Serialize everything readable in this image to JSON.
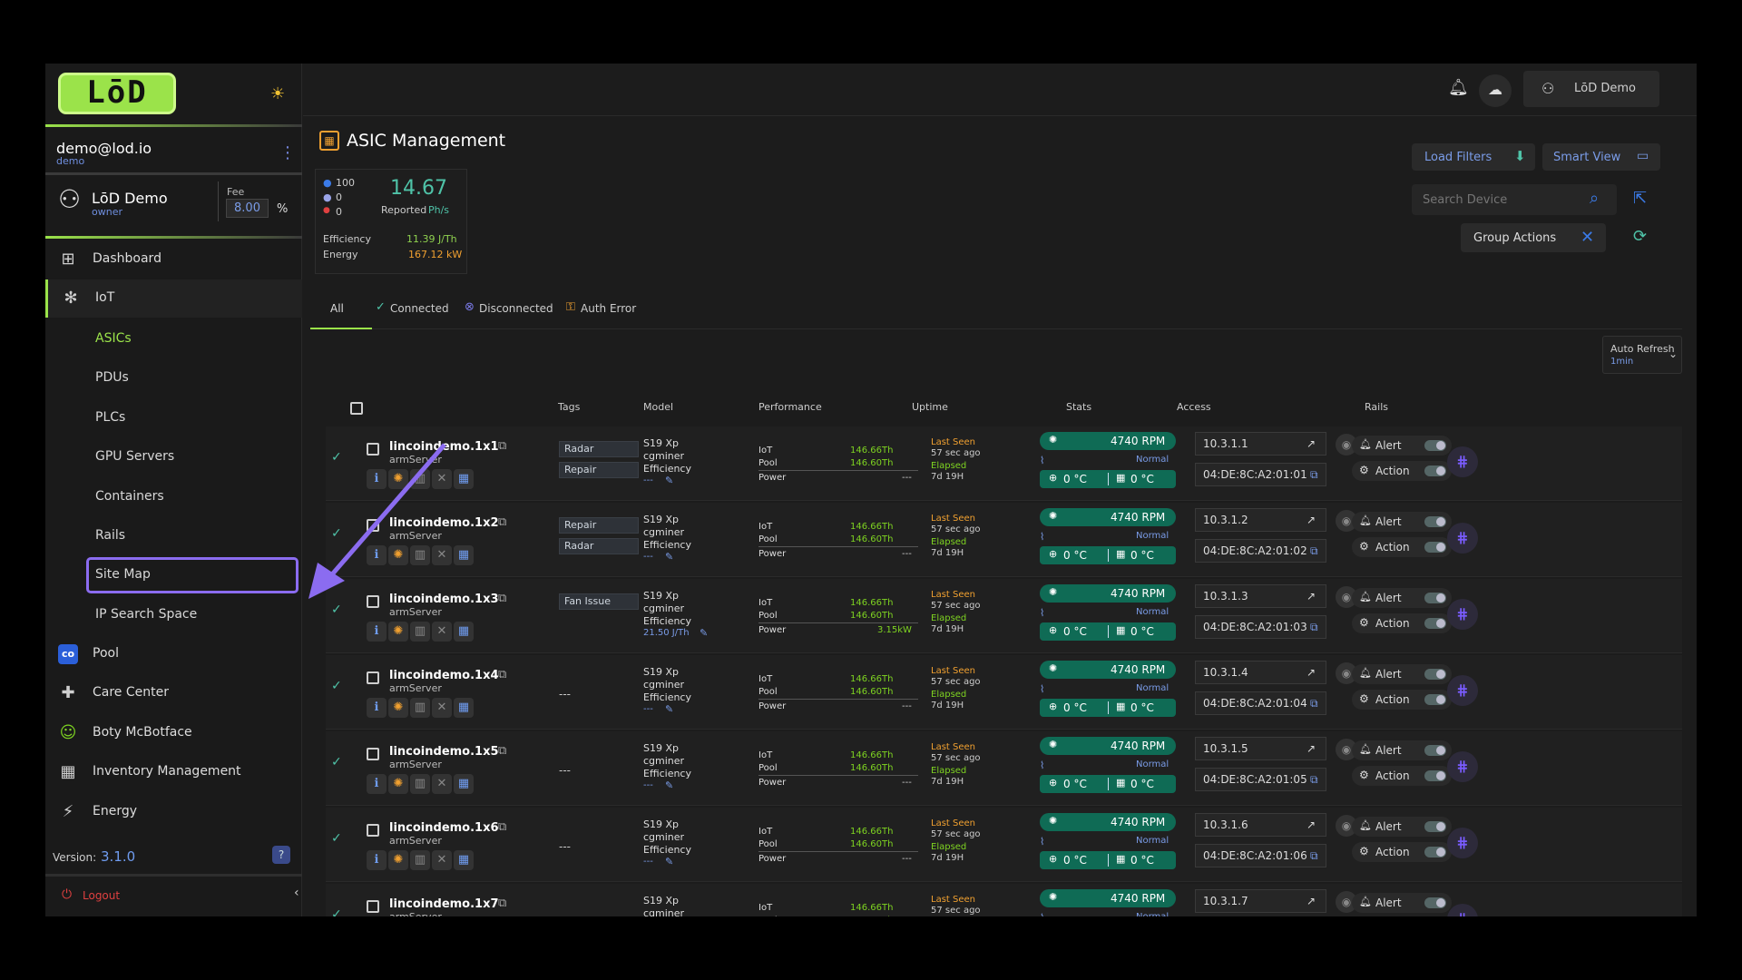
{
  "sidebar": {
    "logo": "LōD",
    "email": "demo@lod.io",
    "email_sub": "demo",
    "user_name": "LōD Demo",
    "user_role": "owner",
    "fee_label": "Fee",
    "fee_value": "8.00",
    "fee_unit": "%",
    "nav": [
      {
        "label": "Dashboard",
        "icon": "dashboard-icon",
        "glyph": "⊞"
      },
      {
        "label": "IoT",
        "icon": "iot-icon",
        "glyph": "✻"
      }
    ],
    "sub_items": [
      "ASICs",
      "PDUs",
      "PLCs",
      "GPU Servers",
      "Containers",
      "Rails",
      "Site Map",
      "IP Search Space"
    ],
    "nav2": [
      {
        "label": "Pool",
        "icon": "pool-icon",
        "glyph": "co"
      },
      {
        "label": "Care Center",
        "icon": "care-center-icon",
        "glyph": "✚"
      },
      {
        "label": "Boty McBotface",
        "icon": "bot-icon",
        "glyph": "☺"
      },
      {
        "label": "Inventory Management",
        "icon": "inventory-icon",
        "glyph": "▦"
      },
      {
        "label": "Energy",
        "icon": "energy-icon",
        "glyph": "⚡"
      }
    ],
    "version_label": "Version:",
    "version": "3.1.0",
    "logout": "Logout"
  },
  "header": {
    "user": "LōD Demo"
  },
  "page": {
    "title": "ASIC Management",
    "summary": {
      "c1": "100",
      "c2": "0",
      "c3": "0",
      "hashrate": "14.67",
      "reported": "Reported",
      "unit": "Ph/s",
      "eff_label": "Efficiency",
      "eff_val": "11.39 J/Th",
      "energy_label": "Energy",
      "energy_val": "167.12 kW"
    },
    "load_filters": "Load Filters",
    "smart_view": "Smart View",
    "search_placeholder": "Search Device",
    "group_actions": "Group Actions",
    "tabs": [
      "All",
      "Connected",
      "Disconnected",
      "Auth Error"
    ],
    "auto_refresh": "Auto Refresh",
    "auto_refresh_val": "1min",
    "columns": [
      "Tags",
      "Model",
      "Performance",
      "Uptime",
      "Stats",
      "Access",
      "Rails"
    ]
  },
  "rows": [
    {
      "name": "lincoindemo.1x1",
      "server": "armServer",
      "tags": [
        "Radar",
        "Repair"
      ],
      "eff": "---",
      "power": "---",
      "ip": "10.3.1.1",
      "mac": "04:DE:8C:A2:01:01"
    },
    {
      "name": "lincoindemo.1x2",
      "server": "armServer",
      "tags": [
        "Repair",
        "Radar"
      ],
      "eff": "---",
      "power": "---",
      "ip": "10.3.1.2",
      "mac": "04:DE:8C:A2:01:02"
    },
    {
      "name": "lincoindemo.1x3",
      "server": "armServer",
      "tags": [
        "Fan Issue"
      ],
      "eff": "21.50 J/Th",
      "power": "3.15kW",
      "ip": "10.3.1.3",
      "mac": "04:DE:8C:A2:01:03"
    },
    {
      "name": "lincoindemo.1x4",
      "server": "armServer",
      "tags": [],
      "eff": "---",
      "power": "---",
      "ip": "10.3.1.4",
      "mac": "04:DE:8C:A2:01:04"
    },
    {
      "name": "lincoindemo.1x5",
      "server": "armServer",
      "tags": [],
      "eff": "---",
      "power": "---",
      "ip": "10.3.1.5",
      "mac": "04:DE:8C:A2:01:05"
    },
    {
      "name": "lincoindemo.1x6",
      "server": "armServer",
      "tags": [],
      "eff": "---",
      "power": "---",
      "ip": "10.3.1.6",
      "mac": "04:DE:8C:A2:01:06"
    },
    {
      "name": "lincoindemo.1x7",
      "server": "armServer",
      "tags": [],
      "eff": "---",
      "power": "---",
      "ip": "10.3.1.7",
      "mac": ""
    }
  ],
  "row_common": {
    "model": "S19 Xp",
    "miner": "cgminer",
    "eff_label": "Efficiency",
    "iot": "IoT",
    "pool": "Pool",
    "power_label": "Power",
    "iot_val": "146.66Th",
    "pool_val": "146.60Th",
    "last_seen": "Last Seen",
    "ago": "57 sec ago",
    "elapsed": "Elapsed",
    "elapsed_val": "7d 19H",
    "rpm": "4740 RPM",
    "normal": "Normal",
    "temp": "0 °C",
    "alert": "Alert",
    "action": "Action",
    "no_tags": "---"
  }
}
